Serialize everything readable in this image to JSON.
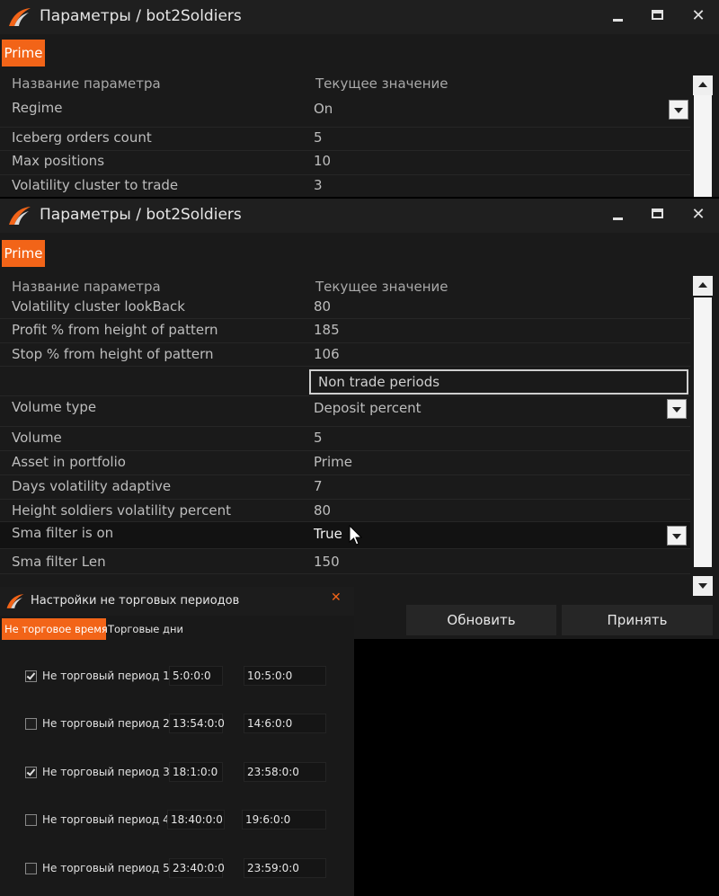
{
  "window_main": {
    "title": "Параметры / bot2Soldiers",
    "tab": "Prime",
    "col_name": "Название параметра",
    "col_value": "Текущее значение"
  },
  "win1_rows": [
    {
      "name": "Regime",
      "value": "On"
    },
    {
      "name": "Iceberg orders count",
      "value": "5"
    },
    {
      "name": "Max positions",
      "value": "10"
    },
    {
      "name": "Volatility cluster to trade",
      "value": "3"
    }
  ],
  "win2_rows": [
    {
      "name": "Volatility cluster lookBack",
      "value": "80"
    },
    {
      "name": "Profit % from height of pattern",
      "value": "185"
    },
    {
      "name": "Stop % from height of pattern",
      "value": "106"
    },
    {
      "name": "",
      "value": "Non trade periods"
    },
    {
      "name": "Volume type",
      "value": "Deposit percent"
    },
    {
      "name": "Volume",
      "value": "5"
    },
    {
      "name": "Asset in portfolio",
      "value": "Prime"
    },
    {
      "name": "Days volatility adaptive",
      "value": "7"
    },
    {
      "name": "Height soldiers volatility percent",
      "value": "80"
    },
    {
      "name": "Sma filter is on",
      "value": "True"
    },
    {
      "name": "Sma filter Len",
      "value": "150"
    }
  ],
  "buttons": {
    "update": "Обновить",
    "accept": "Принять"
  },
  "non_trade_window": {
    "title": "Настройки не торговых периодов",
    "tab_time": "Не торговое время",
    "tab_days": "Торговые дни",
    "periods": [
      {
        "label": "Не торговый период 1",
        "checked": true,
        "start": "5:0:0:0",
        "end": "10:5:0:0"
      },
      {
        "label": "Не торговый период 2",
        "checked": false,
        "start": "13:54:0:0",
        "end": "14:6:0:0"
      },
      {
        "label": "Не торговый период 3",
        "checked": true,
        "start": "18:1:0:0",
        "end": "23:58:0:0"
      },
      {
        "label": "Не торговый период 4",
        "checked": false,
        "start": "18:40:0:0",
        "end": "19:6:0:0"
      },
      {
        "label": "Не торговый период 5",
        "checked": false,
        "start": "23:40:0:0",
        "end": "23:59:0:0"
      }
    ]
  },
  "colors": {
    "accent": "#f26418",
    "background": "#1a1a1a",
    "text": "#bdbdbd"
  },
  "icons": [
    "logo-icon",
    "minimize-icon",
    "maximize-icon",
    "close-icon",
    "chevron-down-icon",
    "chevron-up-icon",
    "checkbox-checked-icon",
    "mouse-cursor-icon"
  ]
}
